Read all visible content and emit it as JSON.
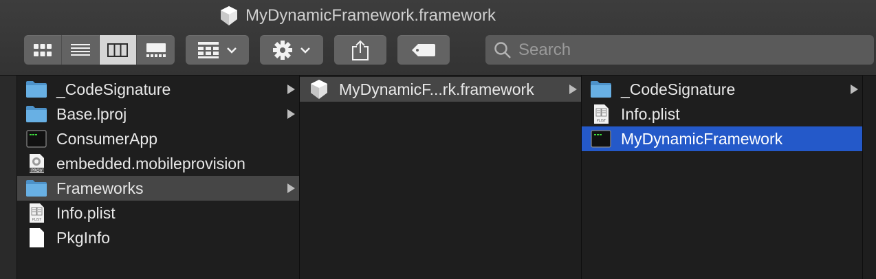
{
  "window": {
    "title": "MyDynamicFramework.framework",
    "title_icon": "framework-icon"
  },
  "toolbar": {
    "view_modes": [
      {
        "name": "icon-view",
        "icon": "grid-icon",
        "active": false
      },
      {
        "name": "list-view",
        "icon": "list-icon",
        "active": false
      },
      {
        "name": "column-view",
        "icon": "columns-icon",
        "active": true
      },
      {
        "name": "gallery-view",
        "icon": "gallery-icon",
        "active": false
      }
    ],
    "group_icon": "group-by-icon",
    "action_icon": "gear-icon",
    "share_icon": "share-icon",
    "tag_icon": "tag-icon",
    "search_placeholder": "Search"
  },
  "columns": [
    {
      "items": [
        {
          "label": "_CodeSignature",
          "icon": "folder-icon",
          "has_children": true,
          "selected": ""
        },
        {
          "label": "Base.lproj",
          "icon": "folder-icon",
          "has_children": true,
          "selected": ""
        },
        {
          "label": "ConsumerApp",
          "icon": "terminal-exec-icon",
          "has_children": false,
          "selected": ""
        },
        {
          "label": "embedded.mobileprovision",
          "icon": "provision-file-icon",
          "has_children": false,
          "selected": ""
        },
        {
          "label": "Frameworks",
          "icon": "folder-icon",
          "has_children": true,
          "selected": "gray"
        },
        {
          "label": "Info.plist",
          "icon": "plist-file-icon",
          "has_children": false,
          "selected": ""
        },
        {
          "label": "PkgInfo",
          "icon": "blank-file-icon",
          "has_children": false,
          "selected": ""
        }
      ]
    },
    {
      "items": [
        {
          "label": "MyDynamicF...rk.framework",
          "icon": "framework-icon",
          "has_children": true,
          "selected": "gray"
        }
      ]
    },
    {
      "items": [
        {
          "label": "_CodeSignature",
          "icon": "folder-icon",
          "has_children": true,
          "selected": ""
        },
        {
          "label": "Info.plist",
          "icon": "plist-file-icon",
          "has_children": false,
          "selected": ""
        },
        {
          "label": "MyDynamicFramework",
          "icon": "terminal-exec-icon",
          "has_children": false,
          "selected": "blue"
        }
      ]
    }
  ],
  "colors": {
    "selection_blue": "#2459c9",
    "selection_gray": "#464646",
    "folder": "#5fa8dc"
  }
}
